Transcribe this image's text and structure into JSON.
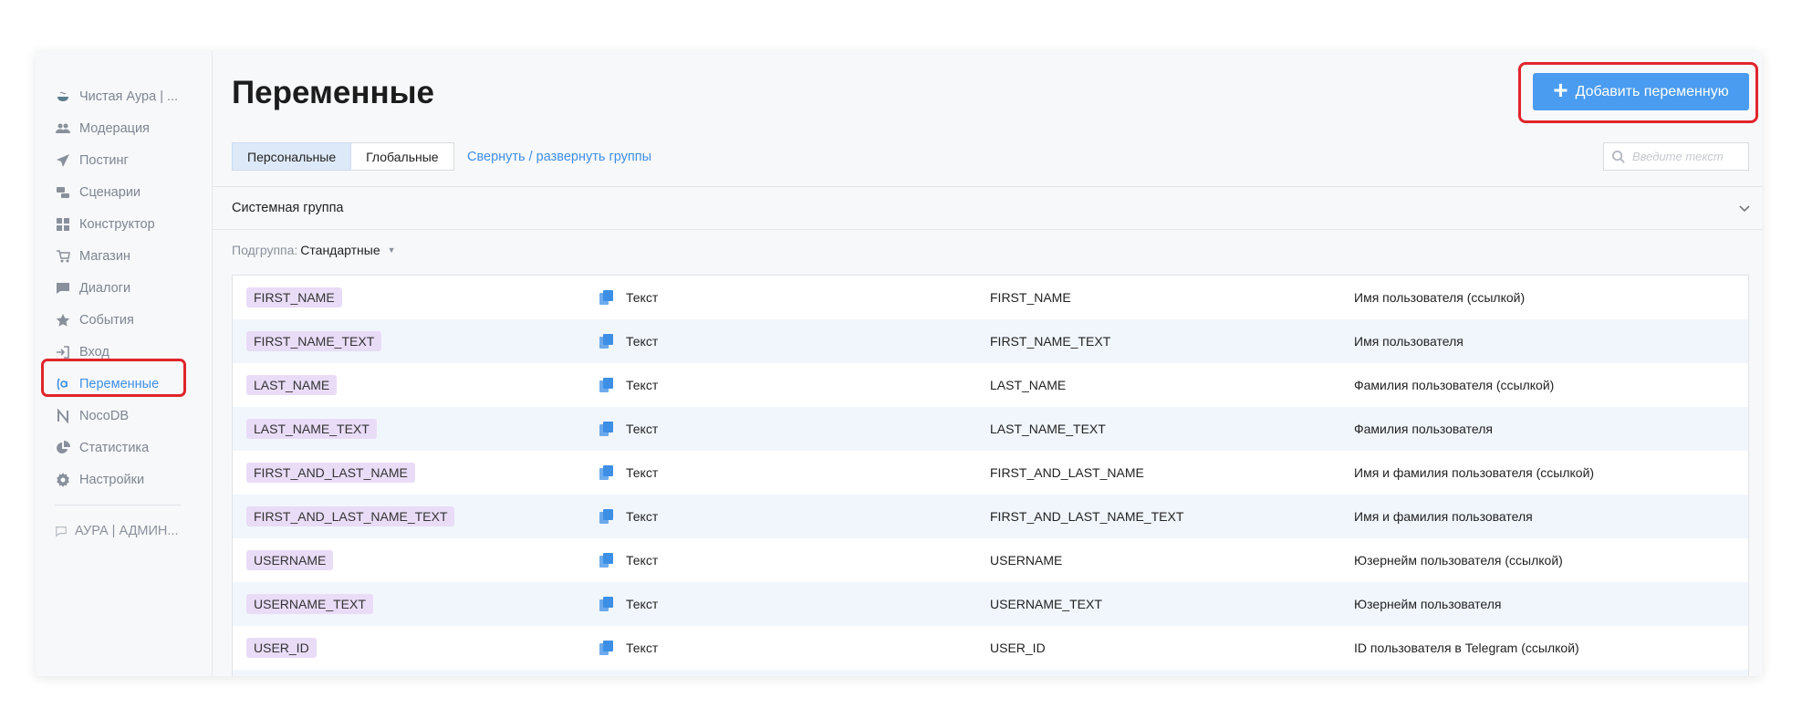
{
  "sidebar": {
    "items": [
      {
        "label": "Чистая Аура | ...",
        "icon": "cup-icon"
      },
      {
        "label": "Модерация",
        "icon": "users-icon"
      },
      {
        "label": "Постинг",
        "icon": "send-icon"
      },
      {
        "label": "Сценарии",
        "icon": "scenarios-icon"
      },
      {
        "label": "Конструктор",
        "icon": "grid-icon"
      },
      {
        "label": "Магазин",
        "icon": "cart-icon"
      },
      {
        "label": "Диалоги",
        "icon": "chat-icon"
      },
      {
        "label": "События",
        "icon": "star-icon"
      },
      {
        "label": "Вход",
        "icon": "login-icon"
      },
      {
        "label": "Переменные",
        "icon": "variable-icon",
        "active": true
      },
      {
        "label": "NocoDB",
        "icon": "nocodb-icon"
      },
      {
        "label": "Статистика",
        "icon": "pie-icon"
      },
      {
        "label": "Настройки",
        "icon": "gear-icon"
      }
    ],
    "bottom_label": "АУРА | АДМИН..."
  },
  "header": {
    "title": "Переменные",
    "add_button_label": "Добавить переменную"
  },
  "tabs": [
    {
      "label": "Персональные",
      "active": true
    },
    {
      "label": "Глобальные",
      "active": false
    }
  ],
  "collapse_link": "Свернуть / развернуть группы",
  "search": {
    "placeholder": "Введите текст"
  },
  "group": {
    "title": "Системная группа"
  },
  "subgroup": {
    "label": "Подгруппа:",
    "value": "Стандартные"
  },
  "rows": [
    {
      "var": "FIRST_NAME",
      "type": "Текст",
      "name": "FIRST_NAME",
      "desc": "Имя пользователя (ссылкой)"
    },
    {
      "var": "FIRST_NAME_TEXT",
      "type": "Текст",
      "name": "FIRST_NAME_TEXT",
      "desc": "Имя пользователя"
    },
    {
      "var": "LAST_NAME",
      "type": "Текст",
      "name": "LAST_NAME",
      "desc": "Фамилия пользователя (ссылкой)"
    },
    {
      "var": "LAST_NAME_TEXT",
      "type": "Текст",
      "name": "LAST_NAME_TEXT",
      "desc": "Фамилия пользователя"
    },
    {
      "var": "FIRST_AND_LAST_NAME",
      "type": "Текст",
      "name": "FIRST_AND_LAST_NAME",
      "desc": "Имя и фамилия пользователя (ссылкой)"
    },
    {
      "var": "FIRST_AND_LAST_NAME_TEXT",
      "type": "Текст",
      "name": "FIRST_AND_LAST_NAME_TEXT",
      "desc": "Имя и фамилия пользователя"
    },
    {
      "var": "USERNAME",
      "type": "Текст",
      "name": "USERNAME",
      "desc": "Юзернейм пользователя (ссылкой)"
    },
    {
      "var": "USERNAME_TEXT",
      "type": "Текст",
      "name": "USERNAME_TEXT",
      "desc": "Юзернейм пользователя"
    },
    {
      "var": "USER_ID",
      "type": "Текст",
      "name": "USER_ID",
      "desc": "ID пользователя в Telegram (ссылкой)"
    }
  ],
  "colors": {
    "accent": "#4a9cf0",
    "link": "#3d8fe6",
    "highlight": "#e0252b",
    "tag_bg": "#e9dcf7",
    "row_alt": "#f1f6fd"
  }
}
